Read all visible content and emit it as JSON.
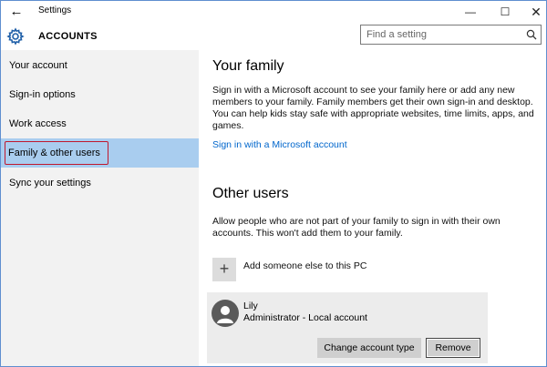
{
  "titlebar": {
    "back_symbol": "←",
    "title": "Settings",
    "min_symbol": "—",
    "max_symbol": "☐",
    "close_symbol": "✕"
  },
  "header": {
    "title": "ACCOUNTS",
    "icon": "gear-icon",
    "search_placeholder": "Find a setting"
  },
  "sidebar": {
    "items": [
      {
        "label": "Your account"
      },
      {
        "label": "Sign-in options"
      },
      {
        "label": "Work access"
      },
      {
        "label": "Family & other users"
      },
      {
        "label": "Sync your settings"
      }
    ],
    "selected_index": 3
  },
  "main": {
    "family": {
      "heading": "Your family",
      "description": "Sign in with a Microsoft account to see your family here or add any new members to your family. Family members get their own sign-in and desktop. You can help kids stay safe with appropriate websites, time limits, apps, and games.",
      "link": "Sign in with a Microsoft account"
    },
    "other_users": {
      "heading": "Other users",
      "description": "Allow people who are not part of your family to sign in with their own accounts. This won't add them to your family.",
      "add_symbol": "+",
      "add_label": "Add someone else to this PC",
      "user": {
        "name": "Lily",
        "role": "Administrator - Local account",
        "change_button": "Change account type",
        "remove_button": "Remove"
      }
    }
  },
  "colors": {
    "selected_nav": "#a9cdef",
    "highlight_border": "#c0182e",
    "link": "#0066cc",
    "sidebar_bg": "#f2f2f2"
  }
}
